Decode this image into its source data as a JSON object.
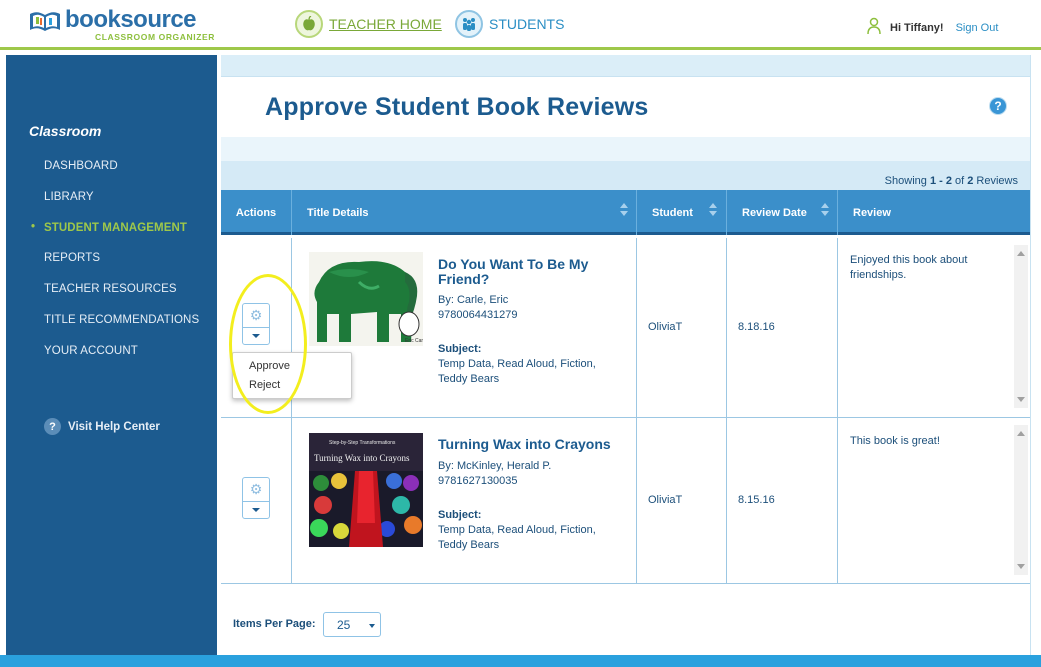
{
  "header": {
    "logo_main": "booksource",
    "logo_sub": "CLASSROOM ORGANIZER",
    "nav": {
      "teacher_home": "TEACHER HOME",
      "students": "STUDENTS"
    },
    "greeting": "Hi Tiffany!",
    "sign_out": "Sign Out"
  },
  "sidebar": {
    "heading": "Classroom",
    "items": [
      {
        "label": "DASHBOARD"
      },
      {
        "label": "LIBRARY"
      },
      {
        "label": "STUDENT MANAGEMENT",
        "active": true
      },
      {
        "label": "REPORTS"
      },
      {
        "label": "TEACHER RESOURCES"
      },
      {
        "label": "TITLE RECOMMENDATIONS"
      },
      {
        "label": "YOUR ACCOUNT"
      }
    ],
    "help": "Visit Help Center"
  },
  "main": {
    "title": "Approve Student Book Reviews",
    "showing": {
      "prefix": "Showing ",
      "range": "1 - 2",
      "of": " of ",
      "total": "2",
      "suffix": " Reviews"
    }
  },
  "table": {
    "headers": [
      "Actions",
      "Title Details",
      "Student",
      "Review Date",
      "Review"
    ],
    "rows": [
      {
        "title_line1": "Do You Want To Be My",
        "title_line2": "Friend?",
        "by": "By: Carle, Eric",
        "isbn": "9780064431279",
        "subject_label": "Subject:",
        "subject_line1": "Temp Data, Read Aloud, Fiction,",
        "subject_line2": "Teddy Bears",
        "student": "OliviaT",
        "date": "8.18.16",
        "review_line1": "Enjoyed this book about",
        "review_line2": "friendships."
      },
      {
        "title_line1": "Turning Wax into Crayons",
        "by": "By: McKinley, Herald P.",
        "isbn": "9781627130035",
        "subject_label": "Subject:",
        "subject_line1": "Temp Data, Read Aloud, Fiction,",
        "subject_line2": "Teddy Bears",
        "student": "OliviaT",
        "date": "8.15.16",
        "review_line1": "This book is great!",
        "cover_text_1": "Step-by-Step Transformations",
        "cover_text_2": "Turning Wax into Crayons"
      }
    ]
  },
  "action_menu": {
    "options": [
      "Approve",
      "Reject"
    ]
  },
  "pager": {
    "items_label": "Items Per Page:",
    "items_value": "25"
  },
  "colors": {
    "brand_blue": "#1c5b8f",
    "header_blue": "#3b8fca",
    "accent_green": "#9ec84a",
    "highlight_yellow": "#f3ee1e"
  }
}
